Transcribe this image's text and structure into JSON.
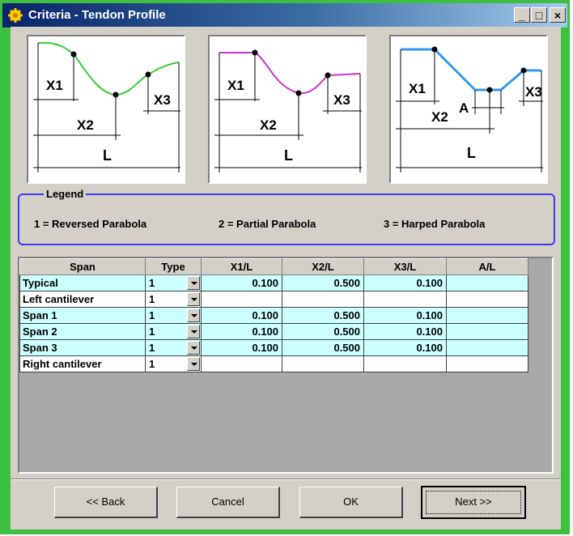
{
  "window": {
    "title": "Criteria - Tendon Profile",
    "buttons": [
      "_",
      "□",
      "×"
    ]
  },
  "diagrams": [
    {
      "name": "reversed-parabola",
      "color": "#33cc33",
      "labels": [
        "X1",
        "X2",
        "X3",
        "L"
      ]
    },
    {
      "name": "partial-parabola",
      "color": "#cc33cc",
      "labels": [
        "X1",
        "X2",
        "X3",
        "L"
      ]
    },
    {
      "name": "harped-parabola",
      "color": "#3399ee",
      "labels": [
        "X1",
        "X2",
        "A",
        "X3",
        "L"
      ]
    }
  ],
  "legend": {
    "title": "Legend",
    "items": [
      "1 = Reversed Parabola",
      "2 = Partial Parabola",
      "3 = Harped Parabola"
    ]
  },
  "table": {
    "columns": [
      "Span",
      "Type",
      "X1/L",
      "X2/L",
      "X3/L",
      "A/L"
    ],
    "rows": [
      {
        "span": "Typical",
        "type": "1",
        "x1": "0.100",
        "x2": "0.500",
        "x3": "0.100",
        "a": "",
        "style": "cyan"
      },
      {
        "span": "Left cantilever",
        "type": "1",
        "x1": "",
        "x2": "",
        "x3": "",
        "a": "",
        "style": "white"
      },
      {
        "span": "Span 1",
        "type": "1",
        "x1": "0.100",
        "x2": "0.500",
        "x3": "0.100",
        "a": "",
        "style": "cyan"
      },
      {
        "span": "Span 2",
        "type": "1",
        "x1": "0.100",
        "x2": "0.500",
        "x3": "0.100",
        "a": "",
        "style": "cyan"
      },
      {
        "span": "Span 3",
        "type": "1",
        "x1": "0.100",
        "x2": "0.500",
        "x3": "0.100",
        "a": "",
        "style": "cyan"
      },
      {
        "span": "Right cantilever",
        "type": "1",
        "x1": "",
        "x2": "",
        "x3": "",
        "a": "",
        "style": "white"
      }
    ]
  },
  "buttons": {
    "back": "<< Back",
    "cancel": "Cancel",
    "ok": "OK",
    "next": "Next >>"
  }
}
